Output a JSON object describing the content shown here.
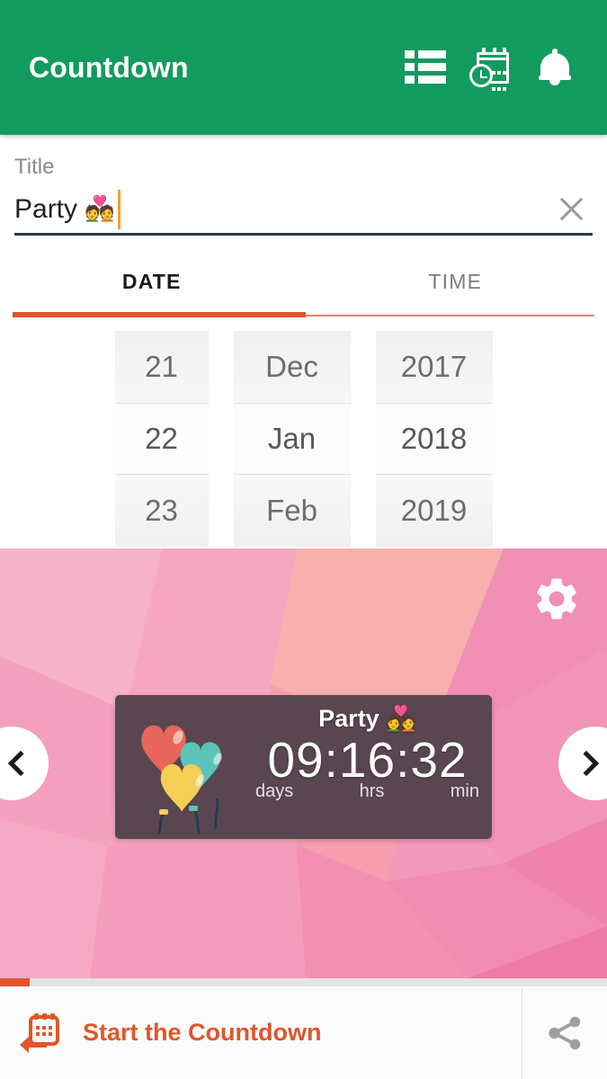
{
  "appbar": {
    "title": "Countdown",
    "actions": [
      {
        "name": "list-icon",
        "label": "List"
      },
      {
        "name": "calendar-clock-icon",
        "label": "Date and time"
      },
      {
        "name": "bell-icon",
        "label": "Notifications"
      }
    ]
  },
  "title_field": {
    "label": "Title",
    "value": "Party",
    "emoji": "💑",
    "clear_label": "Clear"
  },
  "tabs": [
    {
      "label": "DATE",
      "active": true
    },
    {
      "label": "TIME",
      "active": false
    }
  ],
  "date_picker": {
    "days": {
      "above": "21",
      "selected": "22",
      "below": "23"
    },
    "months": {
      "above": "Dec",
      "selected": "Jan",
      "below": "Feb"
    },
    "years": {
      "above": "2017",
      "selected": "2018",
      "below": "2019"
    }
  },
  "preview": {
    "gear_label": "Settings",
    "prev_label": "Previous",
    "next_label": "Next",
    "widget": {
      "title": "Party",
      "emoji": "💑",
      "time": "09:16:32",
      "units": {
        "days": "days",
        "hours": "hrs",
        "minutes": "min"
      },
      "balloon_colors": [
        "#e8665a",
        "#5bc4b8",
        "#f5ce55"
      ],
      "card_color": "#5a4650"
    }
  },
  "bottom_bar": {
    "start_label": "Start the Countdown",
    "share_label": "Share"
  },
  "colors": {
    "appbar_green": "#139a5f",
    "accent_orange": "#e0552b",
    "wallpaper_pink": "#f39aba",
    "caret_orange": "#f0a030"
  }
}
